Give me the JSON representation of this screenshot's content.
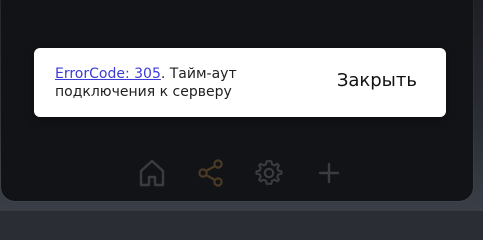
{
  "toast": {
    "error_link": "ErrorCode: 305",
    "message_suffix": ". Тайм-аут подключения к серверу",
    "close_label": "Закрыть"
  },
  "bottom_bar": {
    "icons": [
      "home-icon",
      "share-icon",
      "settings-icon",
      "plus-icon"
    ]
  },
  "colors": {
    "panel_bg": "#121316",
    "toast_bg": "#ffffff",
    "link": "#3b3bd6",
    "icon_dim": "#3a3c40",
    "icon_accent": "#4a3a25"
  }
}
